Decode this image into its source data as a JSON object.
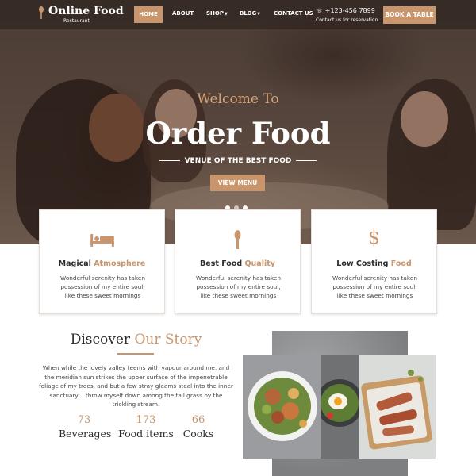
{
  "nav": {
    "logo_title": "Online Food",
    "logo_subtitle": "Restaurant",
    "items": [
      {
        "label": "HOME",
        "active": true
      },
      {
        "label": "ABOUT"
      },
      {
        "label": "SHOP"
      },
      {
        "label": "BLOG"
      },
      {
        "label": "CONTACT US"
      }
    ],
    "phone": "+123-456 7899",
    "reservation_note": "Contact us for reservation",
    "book_button": "BOOK A TABLE"
  },
  "hero": {
    "welcome": "Welcome To",
    "title": "Order Food",
    "tagline": "VENUE OF THE BEST FOOD",
    "button": "VIEW MENU",
    "slides": 3,
    "active_slide": 1
  },
  "features": [
    {
      "icon": "bed-icon",
      "title_plain": "Magical ",
      "title_accent": "Atmosphere",
      "text": "Wonderful serenity has taken possession of my entire soul, like these sweet mornings"
    },
    {
      "icon": "spoon-icon",
      "title_plain": "Best Food ",
      "title_accent": "Quality",
      "text": "Wonderful serenity has taken possession of my entire soul, like these sweet mornings"
    },
    {
      "icon": "dollar-icon",
      "title_plain": "Low Costing ",
      "title_accent": "Food",
      "text": "Wonderful serenity has taken possession of my entire soul, like these sweet mornings"
    }
  ],
  "story": {
    "title_plain": "Discover ",
    "title_accent": "Our Story",
    "text": "When while the lovely valley teems with vapour around me, and the meridian sun strikes the upper surface of the impenetrable foliage of my trees, and but a few stray gleams steal into the inner sanctuary, I throw myself down among the tall grass by the trickling stream.",
    "stats": [
      {
        "value": "73",
        "label": "Beverages"
      },
      {
        "value": "173",
        "label": "Food items"
      },
      {
        "value": "66",
        "label": "Cooks"
      }
    ]
  },
  "colors": {
    "accent": "#c8956c",
    "dark_text": "#2c2c2c"
  }
}
